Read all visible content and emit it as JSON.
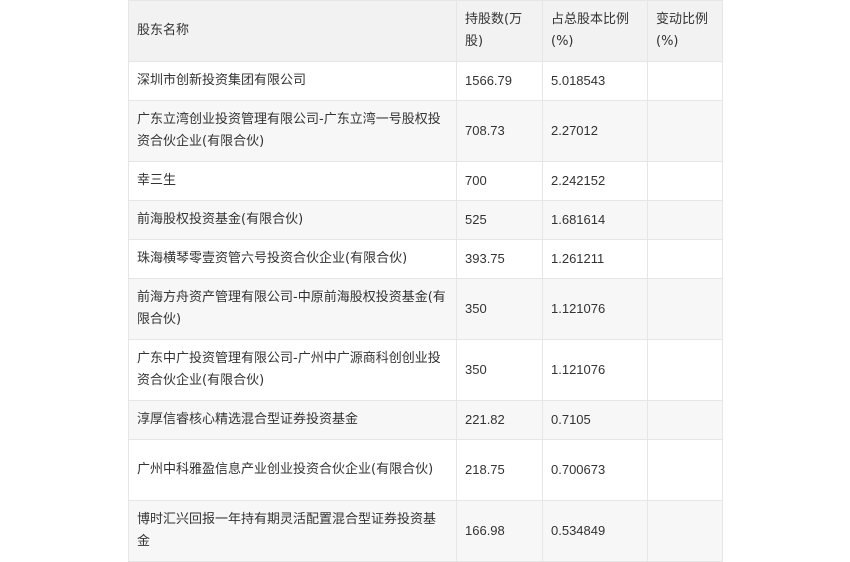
{
  "table": {
    "headers": [
      "股东名称",
      "持股数(万股)",
      "占总股本比例(%)",
      "变动比例(%)"
    ],
    "rows": [
      {
        "name": "深圳市创新投资集团有限公司",
        "shares": "1566.79",
        "ratio": "5.018543",
        "change": ""
      },
      {
        "name": "广东立湾创业投资管理有限公司-广东立湾一号股权投资合伙企业(有限合伙)",
        "shares": "708.73",
        "ratio": "2.27012",
        "change": ""
      },
      {
        "name": "幸三生",
        "shares": "700",
        "ratio": "2.242152",
        "change": ""
      },
      {
        "name": "前海股权投资基金(有限合伙)",
        "shares": "525",
        "ratio": "1.681614",
        "change": ""
      },
      {
        "name": "珠海横琴零壹资管六号投资合伙企业(有限合伙)",
        "shares": "393.75",
        "ratio": "1.261211",
        "change": ""
      },
      {
        "name": "前海方舟资产管理有限公司-中原前海股权投资基金(有限合伙)",
        "shares": "350",
        "ratio": "1.121076",
        "change": ""
      },
      {
        "name": "广东中广投资管理有限公司-广州中广源商科创创业投资合伙企业(有限合伙)",
        "shares": "350",
        "ratio": "1.121076",
        "change": ""
      },
      {
        "name": "淳厚信睿核心精选混合型证券投资基金",
        "shares": "221.82",
        "ratio": "0.7105",
        "change": ""
      },
      {
        "name": "广州中科雅盈信息产业创业投资合伙企业(有限合伙)",
        "shares": "218.75",
        "ratio": "0.700673",
        "change": ""
      },
      {
        "name": "博时汇兴回报一年持有期灵活配置混合型证券投资基金",
        "shares": "166.98",
        "ratio": "0.534849",
        "change": ""
      }
    ]
  }
}
